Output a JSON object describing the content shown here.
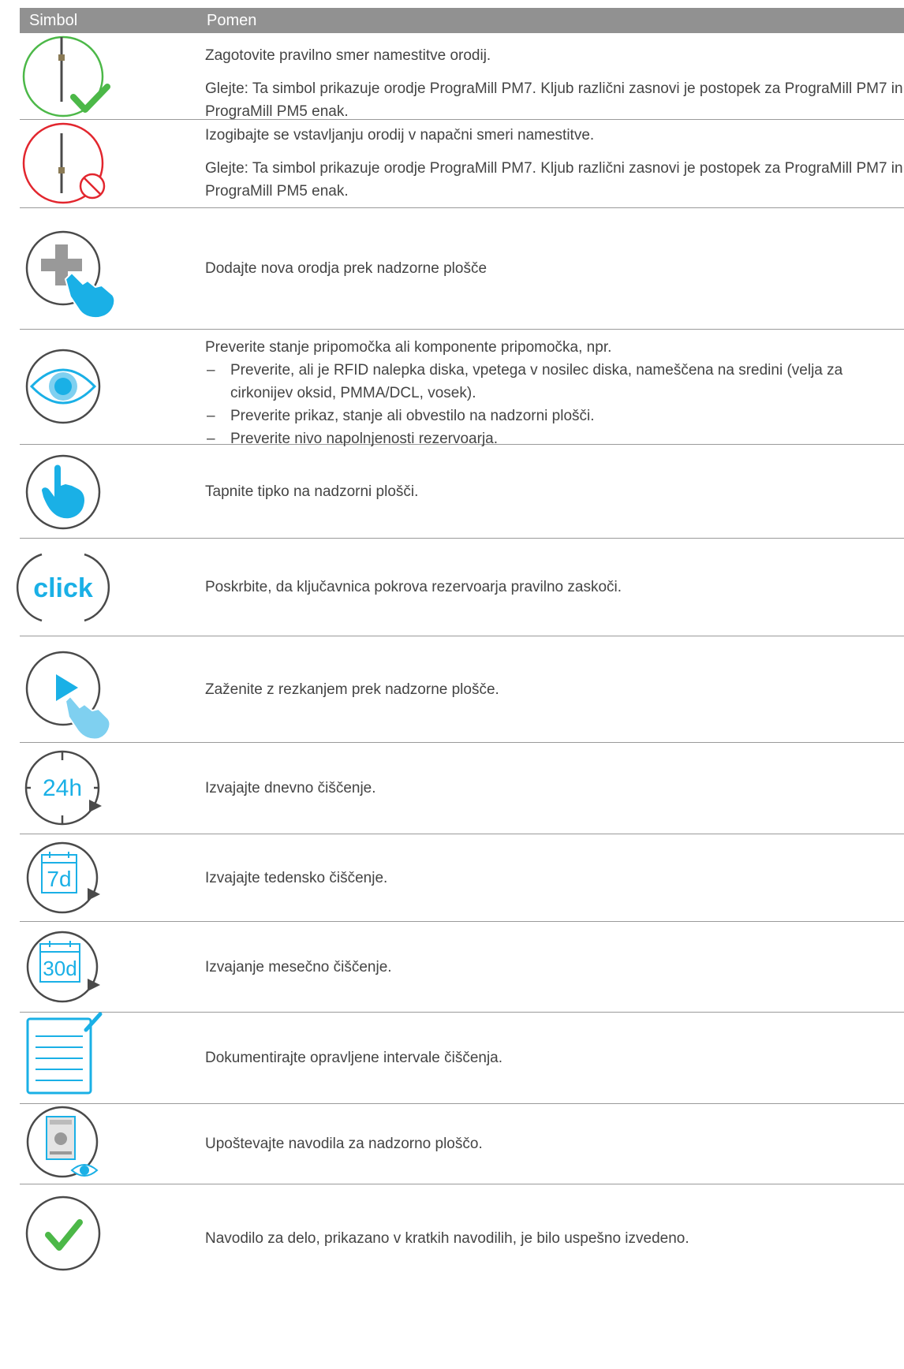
{
  "header": {
    "symbol": "Simbol",
    "meaning": "Pomen"
  },
  "rows": [
    {
      "icon": "tool-correct-orientation-icon",
      "lines": [
        "Zagotovite pravilno smer namestitve orodij."
      ],
      "note": "Glejte: Ta simbol prikazuje orodje PrograMill PM7. Kljub različni zasnovi je postopek za PrograMill PM7 in PrograMill PM5 enak."
    },
    {
      "icon": "tool-wrong-orientation-icon",
      "lines": [
        "Izogibajte se vstavljanju orodij v napačni smeri namestitve."
      ],
      "note": "Glejte: Ta simbol prikazuje orodje PrograMill PM7. Kljub različni zasnovi je postopek za PrograMill PM7 in PrograMill PM5 enak."
    },
    {
      "icon": "add-tool-touch-icon",
      "text": "Dodajte nova orodja prek nadzorne plošče"
    },
    {
      "icon": "eye-check-icon",
      "intro": "Preverite stanje pripomočka ali komponente pripomočka, npr.",
      "bullets": [
        "Preverite, ali je RFID nalepka diska, vpetega v nosilec diska, nameščena na sredini (velja za cirkonijev oksid, PMMA/DCL, vosek).",
        "Preverite prikaz, stanje ali obvestilo na nadzorni plošči.",
        "Preverite nivo napolnjenosti rezervoarja."
      ]
    },
    {
      "icon": "tap-touch-icon",
      "text": "Tapnite tipko na nadzorni plošči."
    },
    {
      "icon": "click-icon",
      "icon_text": "click",
      "text": "Poskrbite, da ključavnica pokrova rezervoarja pravilno zaskoči."
    },
    {
      "icon": "start-milling-touch-icon",
      "text": "Zaženite z rezkanjem prek nadzorne plošče."
    },
    {
      "icon": "daily-cleaning-icon",
      "icon_text": "24h",
      "text": "Izvajajte dnevno čiščenje."
    },
    {
      "icon": "weekly-cleaning-icon",
      "icon_text": "7d",
      "text": "Izvajajte tedensko čiščenje."
    },
    {
      "icon": "monthly-cleaning-icon",
      "icon_text": "30d",
      "text": "Izvajanje mesečno čiščenje."
    },
    {
      "icon": "document-cleaning-icon",
      "text": "Dokumentirajte opravljene intervale čiščenja."
    },
    {
      "icon": "control-panel-instructions-icon",
      "text": "Upoštevajte navodila za nadzorno ploščo."
    },
    {
      "icon": "success-check-icon",
      "text": "Navodilo za delo, prikazano v kratkih navodilih, je bilo uspešno izvedeno."
    }
  ],
  "colors": {
    "header_bg": "#919191",
    "icon_gray": "#4a4a4a",
    "green": "#4cb848",
    "red": "#e2262e",
    "blue": "#1ab0e6"
  }
}
